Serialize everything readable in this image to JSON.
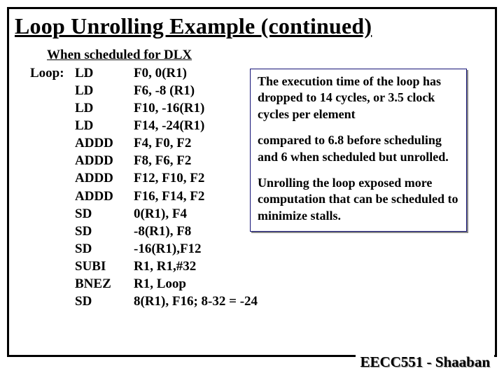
{
  "title": "Loop Unrolling Example (continued)",
  "subhead": "When scheduled for DLX",
  "code": [
    {
      "label": "Loop:",
      "mnem": "LD",
      "ops": "F0, 0(R1)"
    },
    {
      "label": "",
      "mnem": "LD",
      "ops": "F6, -8 (R1)"
    },
    {
      "label": "",
      "mnem": "LD",
      "ops": "F10, -16(R1)"
    },
    {
      "label": "",
      "mnem": "LD",
      "ops": "F14, -24(R1)"
    },
    {
      "label": "",
      "mnem": "ADDD",
      "ops": "F4, F0, F2"
    },
    {
      "label": "",
      "mnem": "ADDD",
      "ops": "F8, F6, F2"
    },
    {
      "label": "",
      "mnem": "ADDD",
      "ops": "F12, F10, F2"
    },
    {
      "label": "",
      "mnem": "ADDD",
      "ops": "F16, F14, F2"
    },
    {
      "label": "",
      "mnem": "SD",
      "ops": " 0(R1), F4"
    },
    {
      "label": "",
      "mnem": "SD",
      "ops": "-8(R1), F8"
    },
    {
      "label": "",
      "mnem": "SD",
      "ops": "-16(R1),F12"
    },
    {
      "label": "",
      "mnem": "SUBI",
      "ops": "R1, R1,#32"
    },
    {
      "label": "",
      "mnem": "BNEZ",
      "ops": " R1, Loop"
    },
    {
      "label": "",
      "mnem": "SD",
      "ops": "8(R1), F16; 8-32 = -24"
    }
  ],
  "note": {
    "p1": "The execution time of the loop has dropped to 14 cycles, or 3.5 clock cycles per element",
    "p2": "compared to 6.8 before scheduling and 6 when scheduled but unrolled.",
    "p3": "Unrolling the loop exposed more computation that can be scheduled to minimize stalls."
  },
  "footer": "EECC551 - Shaaban"
}
